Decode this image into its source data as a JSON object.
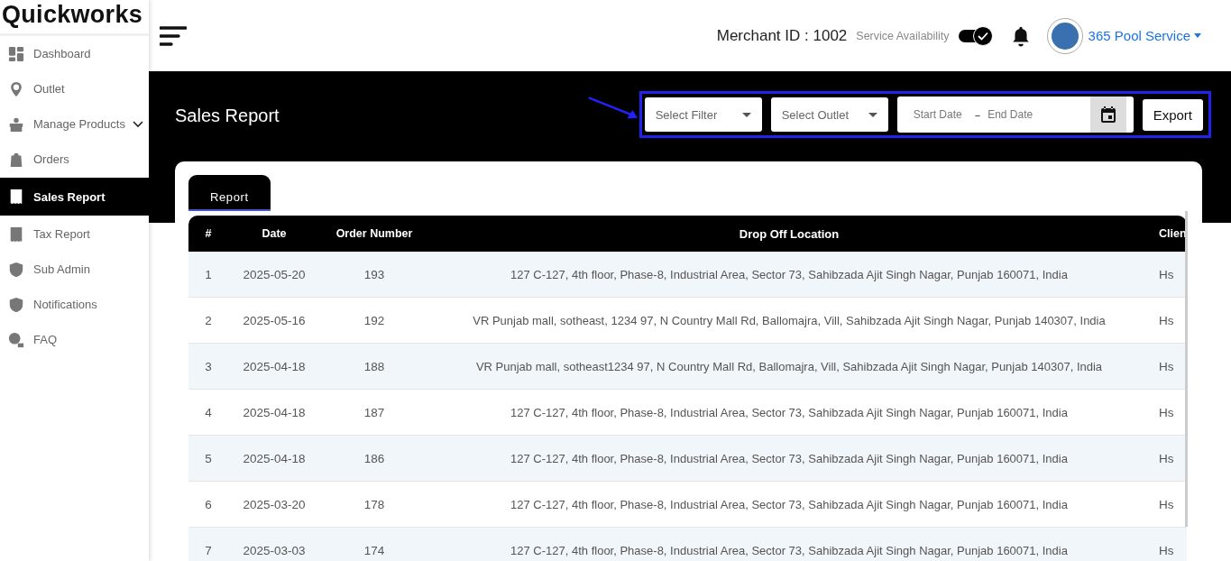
{
  "brand": "Quickworks",
  "sidebar": {
    "items": [
      {
        "label": "Dashboard",
        "selected": false
      },
      {
        "label": "Outlet",
        "selected": false
      },
      {
        "label": "Manage Products",
        "selected": false,
        "has_submenu": true
      },
      {
        "label": "Orders",
        "selected": false
      },
      {
        "label": "Sales Report",
        "selected": true
      },
      {
        "label": "Tax Report",
        "selected": false
      },
      {
        "label": "Sub Admin",
        "selected": false
      },
      {
        "label": "Notifications",
        "selected": false
      },
      {
        "label": "FAQ",
        "selected": false
      }
    ]
  },
  "header": {
    "merchant_id": "Merchant ID : 1002",
    "availability_label": "Service Availability",
    "availability_on": true,
    "user": "365 Pool Service"
  },
  "page_title": "Sales Report",
  "filters": {
    "filter_placeholder": "Select Filter",
    "outlet_placeholder": "Select Outlet",
    "start_placeholder": "Start Date",
    "separator": "–",
    "end_placeholder": "End Date",
    "export": "Export"
  },
  "tabs": [
    {
      "label": "Report",
      "selected": true
    }
  ],
  "table": {
    "columns": [
      "#",
      "Date",
      "Order Number",
      "Drop Off Location",
      "Clien"
    ],
    "rows": [
      [
        "1",
        "2025-05-20",
        "193",
        "127 C-127, 4th floor, Phase-8, Industrial Area, Sector 73, Sahibzada Ajit Singh Nagar, Punjab 160071, India",
        "Hs"
      ],
      [
        "2",
        "2025-05-16",
        "192",
        "VR Punjab mall, sotheast, 1234 97, N Country Mall Rd, Ballomajra, Vill, Sahibzada Ajit Singh Nagar, Punjab 140307, India",
        "Hs"
      ],
      [
        "3",
        "2025-04-18",
        "188",
        "VR Punjab mall, sotheast1234 97, N Country Mall Rd, Ballomajra, Vill, Sahibzada Ajit Singh Nagar, Punjab 140307, India",
        "Hs"
      ],
      [
        "4",
        "2025-04-18",
        "187",
        "127 C-127, 4th floor, Phase-8, Industrial Area, Sector 73, Sahibzada Ajit Singh Nagar, Punjab 160071, India",
        "Hs"
      ],
      [
        "5",
        "2025-04-18",
        "186",
        "127 C-127, 4th floor, Phase-8, Industrial Area, Sector 73, Sahibzada Ajit Singh Nagar, Punjab 160071, India",
        "Hs"
      ],
      [
        "6",
        "2025-03-20",
        "178",
        "127 C-127, 4th floor, Phase-8, Industrial Area, Sector 73, Sahibzada Ajit Singh Nagar, Punjab 160071, India",
        "Hs"
      ],
      [
        "7",
        "2025-03-03",
        "174",
        "127 C-127, 4th floor, Phase-8, Industrial Area, Sector 73, Sahibzada Ajit Singh Nagar, Punjab 160071, India",
        "Hs"
      ]
    ]
  }
}
